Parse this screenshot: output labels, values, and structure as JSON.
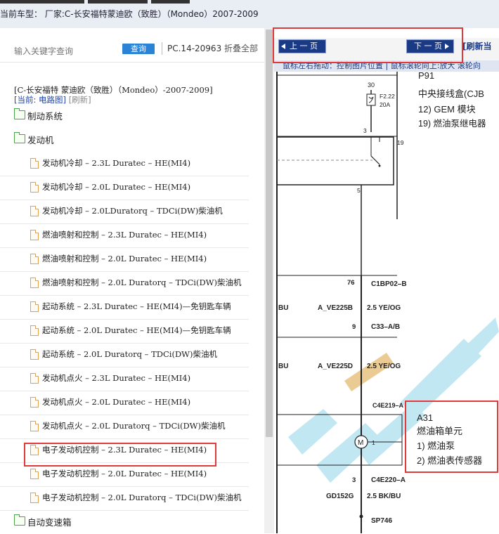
{
  "header": {
    "car_label": "当前车型： 厂家:C-长安福特蒙迪欧（致胜）（Mondeo）2007-2009"
  },
  "search": {
    "placeholder": "输入关键字查询",
    "query_button": "查询",
    "pc_code": "PC.14-20963",
    "collapse_all": "折叠全部"
  },
  "breadcrumb": "[C-长安福特 蒙迪欧（致胜）（Mondeo）-2007-2009]",
  "current": {
    "label": "[当前: ",
    "value": "电路图",
    "close": "]",
    "refresh": "[刷新]"
  },
  "tree": {
    "brake": "制动系统",
    "engine": "发动机",
    "transmission": "自动变速箱",
    "items": [
      "发动机冷却 – 2.3L Duratec – HE(MI4)",
      "发动机冷却 – 2.0L Duratec – HE(MI4)",
      "发动机冷却 – 2.0LDuratorq – TDCi(DW)柴油机",
      "燃油喷射和控制 – 2.3L Duratec – HE(MI4)",
      "燃油喷射和控制 – 2.0L Duratec – HE(MI4)",
      "燃油喷射和控制 – 2.0L Duratorq – TDCi(DW)柴油机",
      "起动系统 – 2.3L Duratec – HE(MI4)—免钥匙车辆",
      "起动系统 – 2.0L Duratec – HE(MI4)—免钥匙车辆",
      "起动系统 – 2.0L Duratorq – TDCi(DW)柴油机",
      "发动机点火 – 2.3L Duratec – HE(MI4)",
      "发动机点火 – 2.0L Duratec – HE(MI4)",
      "发动机点火 – 2.0L Duratorq – TDCi(DW)柴油机",
      "电子发动机控制 – 2.3L Duratec – HE(MI4)",
      "电子发动机控制 – 2.0L Duratec – HE(MI4)",
      "电子发动机控制 – 2.0L Duratorq – TDCi(DW)柴油机"
    ]
  },
  "viewer": {
    "prev": "上 一 页",
    "next": "下 一 页",
    "refresh": "[刷新当",
    "hint": "鼠标左右拖动：控制图片位置 | 鼠标滚轮向上:放大  滚轮向"
  },
  "diagram": {
    "fuse_num": "30",
    "fuse_id": "F2.22",
    "fuse_amp": "20A",
    "pin_3": "3",
    "pin_19": "19",
    "pin_5": "5",
    "p91": "P91",
    "p91_line1": "中央接线盒(CJB",
    "p91_line2": "12) GEM 模块",
    "p91_line3": "19)  燃油泵继电器",
    "pin_76": "76",
    "c1bp02": "C1BP02–B",
    "bu1": "BU",
    "ave225b": "A_VE225B",
    "wire1": "2.5 YE/OG",
    "pin_9": "9",
    "c33": "C33–A/B",
    "bu2": "BU",
    "ave225d": "A_VE225D",
    "wire2": "2.5 YE/OG",
    "c4e219": "C4E219–A",
    "pin_1": "1",
    "a31": "A31",
    "a31_line1": "燃油箱单元",
    "a31_line2": "1)  燃油泵",
    "a31_line3": "2)  燃油表传感器",
    "pin_3b": "3",
    "c4e220": "C4E220–A",
    "gd152g": "GD152G",
    "wire3": "2.5 BK/BU",
    "sp746": "SP746"
  },
  "colors": {
    "accent": "#2b83d6",
    "nav_button": "#1b3a86",
    "highlight_box": "#e23a3a",
    "folder": "#4aa34a",
    "doc": "#e0a050"
  }
}
